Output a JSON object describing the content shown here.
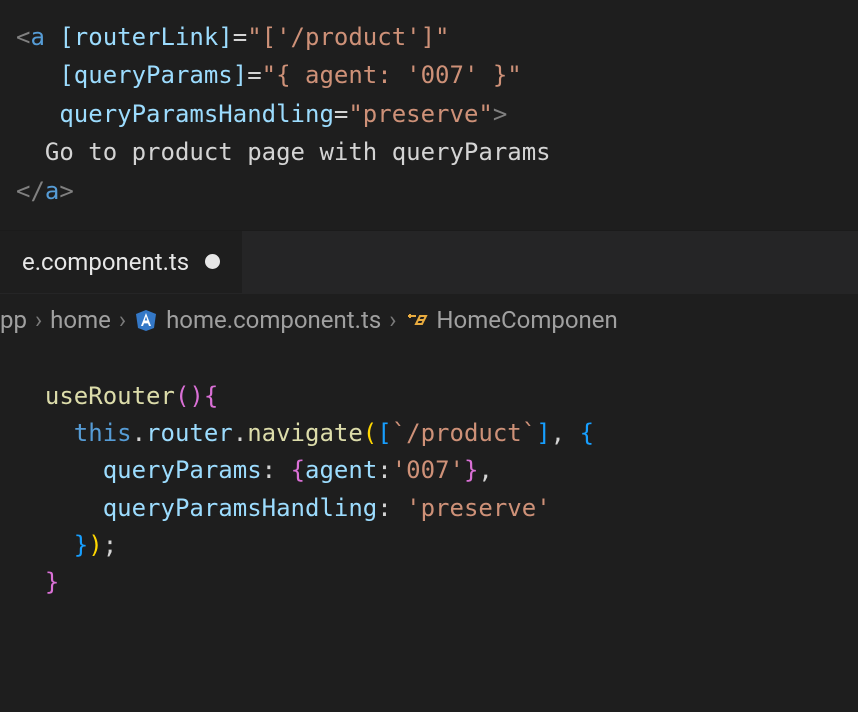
{
  "top_code": {
    "l1": {
      "open": "<",
      "tag": "a",
      "attr": "[routerLink]",
      "eq": "=",
      "val": "\"['/product']\""
    },
    "l2": {
      "attr": "[queryParams]",
      "eq": "=",
      "val": "\"{ agent: '007' }\""
    },
    "l3": {
      "attr": "queryParamsHandling",
      "eq": "=",
      "val": "\"preserve\"",
      "close": ">"
    },
    "l4": {
      "text": "Go to product page with queryParams"
    },
    "l5": {
      "open": "</",
      "tag": "a",
      "close": ">"
    }
  },
  "tab": {
    "label": "e.component.ts"
  },
  "breadcrumb": {
    "items": [
      "pp",
      "home",
      "home.component.ts",
      "HomeComponen"
    ]
  },
  "bottom_code": {
    "l1": {
      "fn": "useRouter",
      "paren": "()",
      "brace": "{"
    },
    "l2": {
      "this": "this",
      "dot1": ".",
      "router": "router",
      "dot2": ".",
      "nav": "navigate",
      "p_open": "(",
      "br_open": "[",
      "tpl": "`/product`",
      "br_close": "]",
      "comma": ", ",
      "obj_open": "{"
    },
    "l3": {
      "key": "queryParams",
      "colon": ": ",
      "open": "{",
      "k2": "agent",
      "colon2": ":",
      "v": "'007'",
      "close": "}",
      "comma": ","
    },
    "l4": {
      "key": "queryParamsHandling",
      "colon": ": ",
      "v": "'preserve'"
    },
    "l5": {
      "obj_close": "}",
      "p_close": ")",
      "semi": ";"
    },
    "l6": {
      "brace": "}"
    }
  }
}
